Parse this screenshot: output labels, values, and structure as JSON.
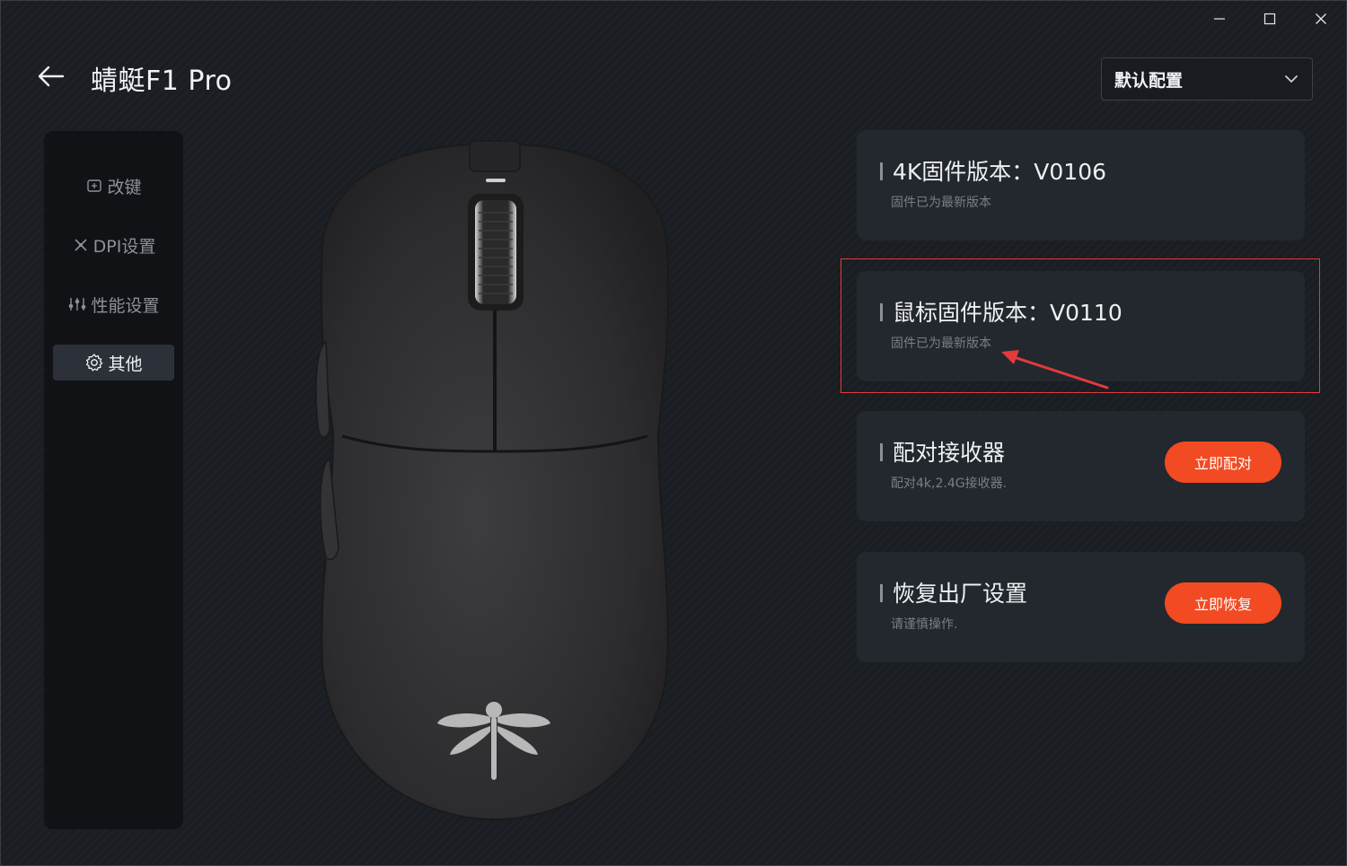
{
  "window": {
    "title": "蜻蜓F1 Pro",
    "controls": [
      "minimize",
      "maximize",
      "close"
    ]
  },
  "config_select": {
    "value": "默认配置"
  },
  "sidebar": {
    "items": [
      {
        "label": "改键",
        "icon": "keymap-icon",
        "active": false
      },
      {
        "label": "DPI设置",
        "icon": "dpi-icon",
        "active": false
      },
      {
        "label": "性能设置",
        "icon": "sliders-icon",
        "active": false
      },
      {
        "label": "其他",
        "icon": "gear-icon",
        "active": true
      }
    ]
  },
  "cards": [
    {
      "title": "4K固件版本：V0106",
      "subtitle": "固件已为最新版本"
    },
    {
      "title": "鼠标固件版本：V0110",
      "subtitle": "固件已为最新版本"
    },
    {
      "title": "配对接收器",
      "subtitle": "配对4k,2.4G接收器.",
      "button": "立即配对"
    },
    {
      "title": "恢复出厂设置",
      "subtitle": "请谨慎操作.",
      "button": "立即恢复"
    }
  ],
  "colors": {
    "accent": "#f24a23",
    "annotation": "#e23b3b",
    "background": "#1a1d22",
    "card": "#23272e"
  }
}
